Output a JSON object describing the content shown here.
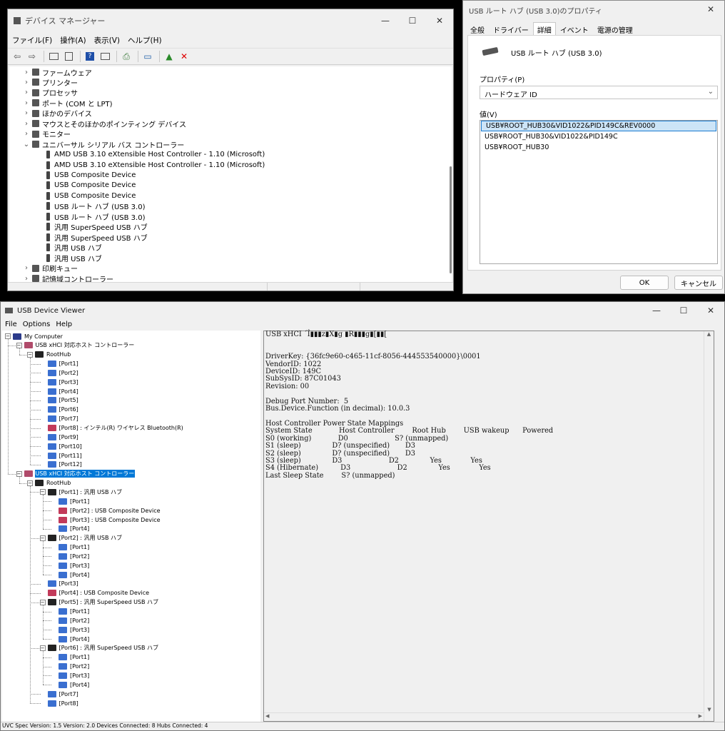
{
  "device_manager": {
    "title": "デバイス マネージャー",
    "menu": [
      "ファイル(F)",
      "操作(A)",
      "表示(V)",
      "ヘルプ(H)"
    ],
    "tree": [
      {
        "label": "ファームウェア",
        "chev": "›"
      },
      {
        "label": "プリンター",
        "chev": "›"
      },
      {
        "label": "プロセッサ",
        "chev": "›"
      },
      {
        "label": "ポート (COM と LPT)",
        "chev": "›"
      },
      {
        "label": "ほかのデバイス",
        "chev": "›"
      },
      {
        "label": "マウスとそのほかのポインティング デバイス",
        "chev": "›"
      },
      {
        "label": "モニター",
        "chev": "›"
      },
      {
        "label": "ユニバーサル シリアル バス コントローラー",
        "chev": "⌄"
      },
      {
        "label": "AMD USB 3.10 eXtensible Host Controller - 1.10 (Microsoft)",
        "child": true
      },
      {
        "label": "AMD USB 3.10 eXtensible Host Controller - 1.10 (Microsoft)",
        "child": true
      },
      {
        "label": "USB Composite Device",
        "child": true
      },
      {
        "label": "USB Composite Device",
        "child": true
      },
      {
        "label": "USB Composite Device",
        "child": true
      },
      {
        "label": "USB ルート ハブ (USB 3.0)",
        "child": true
      },
      {
        "label": "USB ルート ハブ (USB 3.0)",
        "child": true
      },
      {
        "label": "汎用 SuperSpeed USB ハブ",
        "child": true
      },
      {
        "label": "汎用 SuperSpeed USB ハブ",
        "child": true
      },
      {
        "label": "汎用 USB ハブ",
        "child": true
      },
      {
        "label": "汎用 USB ハブ",
        "child": true
      },
      {
        "label": "印刷キュー",
        "chev": "›"
      },
      {
        "label": "記憶域コントローラー",
        "chev": "›"
      }
    ]
  },
  "properties": {
    "title": "USB ルート ハブ (USB 3.0)のプロパティ",
    "tabs": [
      "全般",
      "ドライバー",
      "詳細",
      "イベント",
      "電源の管理"
    ],
    "active_tab": "詳細",
    "device_name": "USB ルート ハブ (USB 3.0)",
    "property_label": "プロパティ(P)",
    "property_value": "ハードウェア ID",
    "value_label": "値(V)",
    "values": [
      "USB¥ROOT_HUB30&VID1022&PID149C&REV0000",
      "USB¥ROOT_HUB30&VID1022&PID149C",
      "USB¥ROOT_HUB30"
    ],
    "ok": "OK",
    "cancel": "キャンセル",
    "close": "✕"
  },
  "usbview": {
    "title": "USB Device Viewer",
    "menu": [
      "File",
      "Options",
      "Help"
    ],
    "caption": {
      "min": "—",
      "max": "☐",
      "close": "✕"
    },
    "tree": [
      {
        "d": 0,
        "icon": "comp",
        "label": "My Computer",
        "pm": "−"
      },
      {
        "d": 1,
        "icon": "ctrl",
        "label": "USB xHCI 対応ホスト コントローラー",
        "pm": "−"
      },
      {
        "d": 2,
        "icon": "hub",
        "label": "RootHub",
        "pm": "−"
      },
      {
        "d": 3,
        "icon": "port",
        "label": "[Port1]"
      },
      {
        "d": 3,
        "icon": "port",
        "label": "[Port2]"
      },
      {
        "d": 3,
        "icon": "port",
        "label": "[Port3]"
      },
      {
        "d": 3,
        "icon": "port",
        "label": "[Port4]"
      },
      {
        "d": 3,
        "icon": "port",
        "label": "[Port5]"
      },
      {
        "d": 3,
        "icon": "port",
        "label": "[Port6]"
      },
      {
        "d": 3,
        "icon": "port",
        "label": "[Port7]"
      },
      {
        "d": 3,
        "icon": "portdev",
        "label": "[Port8] : インテル(R) ワイヤレス Bluetooth(R)"
      },
      {
        "d": 3,
        "icon": "port",
        "label": "[Port9]"
      },
      {
        "d": 3,
        "icon": "port",
        "label": "[Port10]"
      },
      {
        "d": 3,
        "icon": "port",
        "label": "[Port11]"
      },
      {
        "d": 3,
        "icon": "port",
        "label": "[Port12]"
      },
      {
        "d": 1,
        "icon": "ctrl",
        "label": "USB xHCI 対応ホスト コントローラー",
        "pm": "−",
        "selected": true
      },
      {
        "d": 2,
        "icon": "hub",
        "label": "RootHub",
        "pm": "−"
      },
      {
        "d": 3,
        "icon": "hub",
        "label": "[Port1] : 汎用 USB ハブ",
        "pm": "−"
      },
      {
        "d": 4,
        "icon": "port",
        "label": "[Port1]"
      },
      {
        "d": 4,
        "icon": "portdev",
        "label": "[Port2] : USB Composite Device"
      },
      {
        "d": 4,
        "icon": "portdev",
        "label": "[Port3] : USB Composite Device"
      },
      {
        "d": 4,
        "icon": "port",
        "label": "[Port4]"
      },
      {
        "d": 3,
        "icon": "hub",
        "label": "[Port2] : 汎用 USB ハブ",
        "pm": "−"
      },
      {
        "d": 4,
        "icon": "port",
        "label": "[Port1]"
      },
      {
        "d": 4,
        "icon": "port",
        "label": "[Port2]"
      },
      {
        "d": 4,
        "icon": "port",
        "label": "[Port3]"
      },
      {
        "d": 4,
        "icon": "port",
        "label": "[Port4]"
      },
      {
        "d": 3,
        "icon": "port",
        "label": "[Port3]"
      },
      {
        "d": 3,
        "icon": "portdev",
        "label": "[Port4] : USB Composite Device"
      },
      {
        "d": 3,
        "icon": "hub",
        "label": "[Port5] : 汎用 SuperSpeed USB ハブ",
        "pm": "−"
      },
      {
        "d": 4,
        "icon": "port",
        "label": "[Port1]"
      },
      {
        "d": 4,
        "icon": "port",
        "label": "[Port2]"
      },
      {
        "d": 4,
        "icon": "port",
        "label": "[Port3]"
      },
      {
        "d": 4,
        "icon": "port",
        "label": "[Port4]"
      },
      {
        "d": 3,
        "icon": "hub",
        "label": "[Port6] : 汎用 SuperSpeed USB ハブ",
        "pm": "−"
      },
      {
        "d": 4,
        "icon": "port",
        "label": "[Port1]"
      },
      {
        "d": 4,
        "icon": "port",
        "label": "[Port2]"
      },
      {
        "d": 4,
        "icon": "port",
        "label": "[Port3]"
      },
      {
        "d": 4,
        "icon": "port",
        "label": "[Port4]"
      },
      {
        "d": 3,
        "icon": "port",
        "label": "[Port7]"
      },
      {
        "d": 3,
        "icon": "port",
        "label": "[Port8]"
      }
    ],
    "details": "USB xHCI ´Î▮▮▮z▮X▮g ▮R▮▮▮g▮[▮▮[\n\n\nDriverKey: {36fc9e60-c465-11cf-8056-444553540000}\\0001\nVendorID: 1022\nDeviceID: 149C\nSubSysID: 87C01043\nRevision: 00\n\nDebug Port Number:  5\nBus.Device.Function (in decimal): 10.0.3\n\nHost Controller Power State Mappings\nSystem State            Host Controller        Root Hub        USB wakeup      Powered\nS0 (working)            D0                     S? (unmapped)\nS1 (sleep)              D? (unspecified)       D3\nS2 (sleep)              D? (unspecified)       D3\nS3 (sleep)              D3                     D2              Yes             Yes\nS4 (Hibernate)          D3                     D2              Yes             Yes\nLast Sleep State        S? (unmapped)",
    "status": "UVC Spec Version: 1.5 Version: 2.0 Devices Connected: 8   Hubs Connected: 4"
  }
}
